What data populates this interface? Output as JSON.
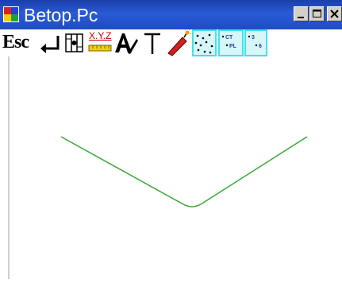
{
  "window": {
    "title": "Betop.Pc"
  },
  "toolbar": {
    "esc_label": "Esc",
    "xyz_label": "X.Y.Z",
    "tools": [
      {
        "name": "escape",
        "icon": "esc-text-icon"
      },
      {
        "name": "enter",
        "icon": "enter-arrow-icon"
      },
      {
        "name": "panel",
        "icon": "panel-icon"
      },
      {
        "name": "coordinates",
        "icon": "xyz-coordinates-icon"
      },
      {
        "name": "text",
        "icon": "text-pen-icon"
      },
      {
        "name": "perpendicular",
        "icon": "t-perpendicular-icon"
      },
      {
        "name": "explode",
        "icon": "dynamite-icon"
      },
      {
        "name": "points",
        "icon": "scattered-points-icon"
      },
      {
        "name": "ct-pl",
        "icon": "ct-pl-points-icon"
      },
      {
        "name": "numbered-points",
        "icon": "numbered-points-icon"
      }
    ]
  },
  "colors": {
    "titlebar": "#2a5ad6",
    "polyline": "#3aa83a",
    "tool_frame": "#3ee2ec",
    "tool_fill": "#d8f6f8"
  }
}
